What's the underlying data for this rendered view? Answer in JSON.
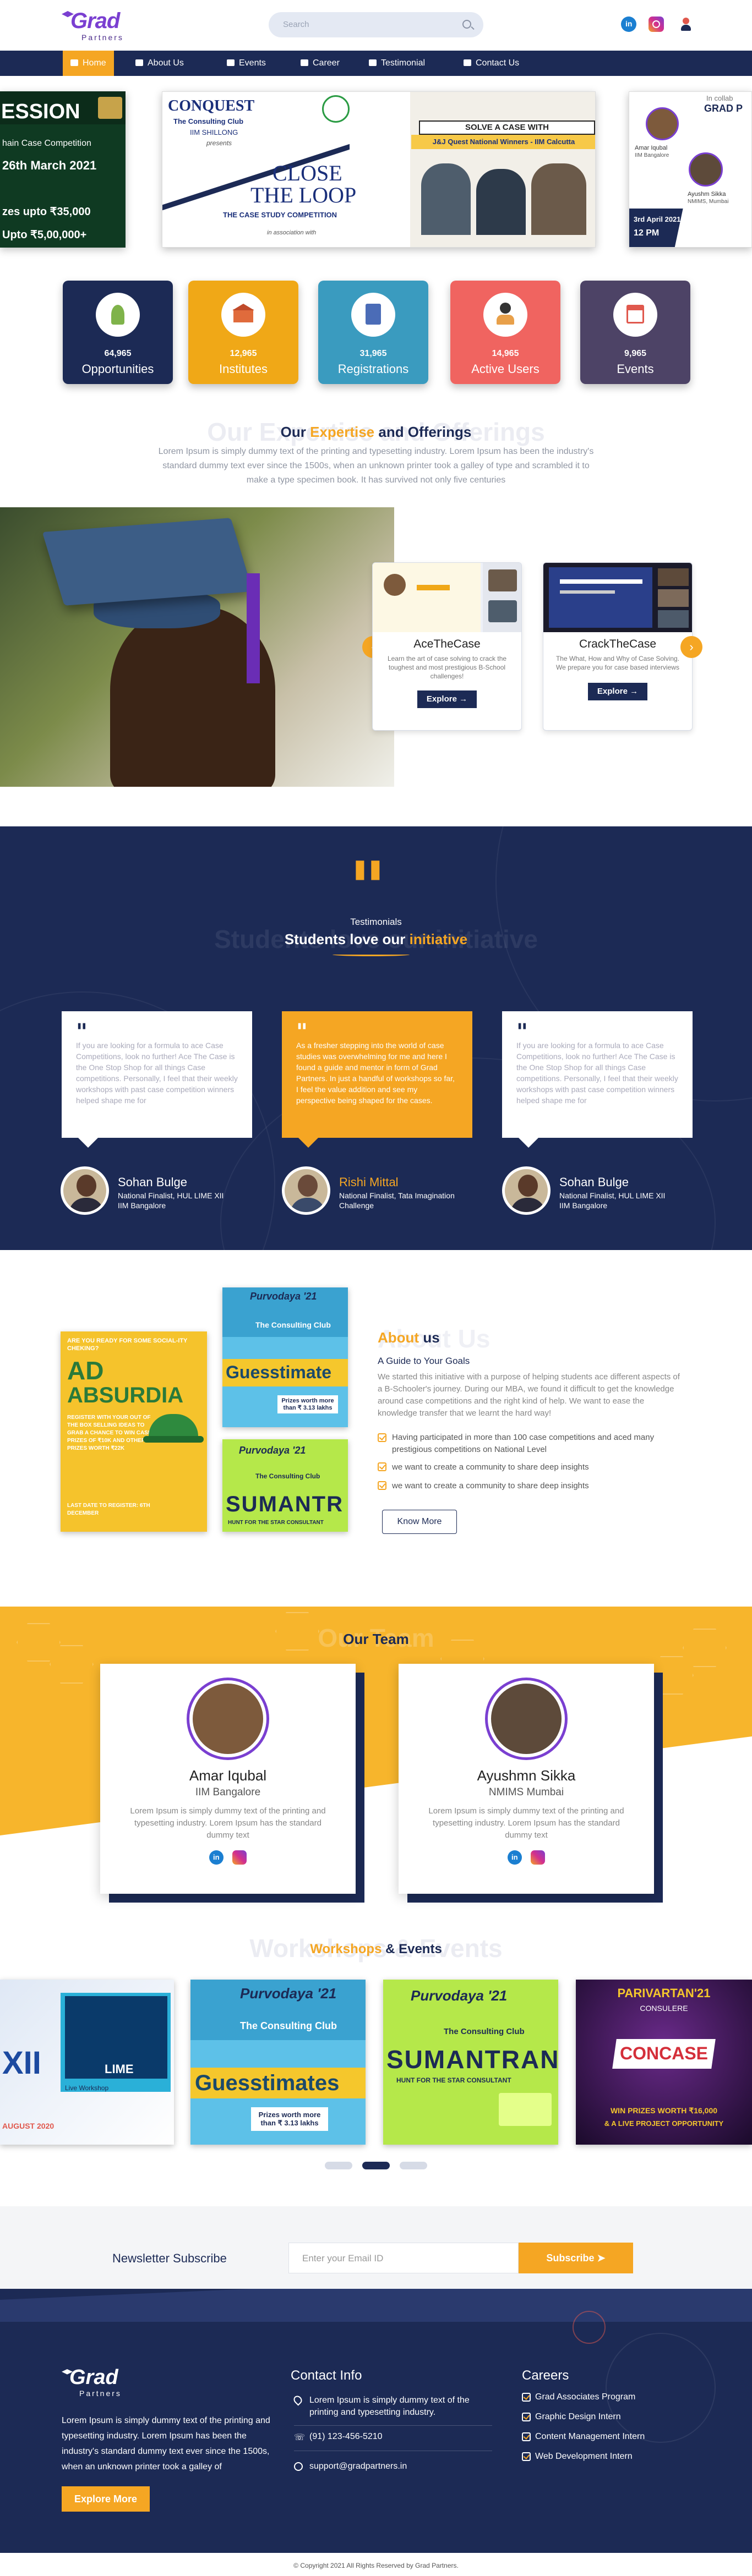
{
  "header": {
    "logo_text": "Grad",
    "logo_sub": "Partners",
    "search_placeholder": "Search"
  },
  "nav": {
    "items": [
      "Home",
      "About Us",
      "Events",
      "Career",
      "Testimonial",
      "Contact Us"
    ]
  },
  "banners": {
    "left": {
      "title": "ESSION",
      "line1": "hain Case Competition",
      "line2": "26th March 2021",
      "line3": "zes upto ₹35,000",
      "line4": "Upto ₹5,00,000+"
    },
    "center": {
      "title1": "CONQUEST",
      "title2": "The Consulting Club",
      "title3": "IIM SHILLONG",
      "title4": "presents",
      "big1": "CLOSE",
      "big2": "THE LOOP",
      "sub": "THE CASE STUDY COMPETITION",
      "assoc": "in association with",
      "right_head": "SOLVE A CASE WITH",
      "right_sub": "J&J Quest National Winners - IIM Calcutta"
    },
    "right": {
      "brand": "GRAD P",
      "name1": "Amar Iqubal",
      "sch1": "IIM Bangalore",
      "name2": "Ayushm Sikka",
      "sch2": "NMIMS, Mumbai",
      "date": "3rd April 2021",
      "time": "12 PM",
      "tag": "In collab"
    }
  },
  "stats": [
    {
      "num": "64,965",
      "label": "Opportunities",
      "color": "#1c2a55"
    },
    {
      "num": "12,965",
      "label": "Institutes",
      "color": "#f0a817"
    },
    {
      "num": "31,965",
      "label": "Registrations",
      "color": "#3a9bbf"
    },
    {
      "num": "14,965",
      "label": "Active Users",
      "color": "#f06460"
    },
    {
      "num": "9,965",
      "label": "Events",
      "color": "#4d4366"
    }
  ],
  "expertise": {
    "ghost": "Our Expertise and Offerings",
    "pre": "Our ",
    "accent": "Expertise",
    "post": " and Offerings",
    "desc": "Lorem Ipsum is simply dummy text of the printing and typesetting industry. Lorem Ipsum has been the industry's standard dummy text ever since the 1500s, when an unknown printer took a galley of type and scrambled it to make a type specimen book. It has survived not only five centuries",
    "cards": [
      {
        "title": "AceTheCase",
        "desc": "Learn the art of case solving to crack the toughest and most prestigious B-School challenges!",
        "btn": "Explore"
      },
      {
        "title": "CrackTheCase",
        "desc": "The What, How and Why of Case Solving. We prepare you for case based interviews",
        "btn": "Explore"
      }
    ]
  },
  "testimonials": {
    "label": "Testimonials",
    "ghost": "Students love our initiative",
    "pre": "Students love our ",
    "accent": "initiative",
    "cards": [
      {
        "text": "If you are looking for a formula to ace Case Competitions, look no further! Ace The Case is the One Stop Shop for all things Case competitions. Personally, I feel that their weekly workshops with past case competition winners helped shape me for",
        "name": "Sohan Bulge",
        "role1": "National Finalist, HUL LIME XII",
        "role2": "IIM Bangalore"
      },
      {
        "text": "As a fresher stepping into the world of case studies was overwhelming for me and here I found a guide and mentor in form of Grad Partners. In just a handful of workshops so far, I feel the value addition and see my perspective being shaped for the cases.",
        "name": "Rishi Mittal",
        "role1": "National Finalist, Tata Imagination",
        "role2": "Challenge"
      },
      {
        "text": "If you are looking for a formula to ace Case Competitions, look no further! Ace The Case is the One Stop Shop for all things Case competitions. Personally, I feel that their weekly workshops with past case competition winners helped shape me for",
        "name": "Sohan Bulge",
        "role1": "National Finalist, HUL LIME XII",
        "role2": "IIM Bangalore"
      }
    ]
  },
  "about": {
    "ghost": "About Us",
    "accent": "About",
    "post": " us",
    "subtitle": "A Guide to Your Goals",
    "desc": "We started this initiative with a purpose of helping students ace different aspects of a B-Schooler's journey. During our MBA, we found it difficult to get the knowledge around case competitions and the right kind of help. We want to ease the knowledge transfer that we learnt the hard way!",
    "points": [
      "Having participated in more than 100 case competitions and aced many prestigious competitions on National Level",
      "we want to create a community to share deep insights",
      "we want to create a community to share deep insights"
    ],
    "btn": "Know More",
    "poster1": {
      "top": "ARE YOU READY FOR SOME SOCIAL-ITY CHEKING?",
      "big1": "AD",
      "big2": "ABSURDIA",
      "body": "REGISTER WITH YOUR OUT OF THE BOX SELLING IDEAS TO GRAB A CHANCE TO WIN CASH PRIZES OF ₹10K AND OTHER PRIZES WORTH ₹22K",
      "foot": "LAST DATE TO REGISTER: 6TH DECEMBER"
    },
    "poster2": {
      "brand": "Purvodaya '21",
      "club": "The Consulting Club",
      "big": "Guesstimate",
      "prize": "Prizes worth more than ₹ 3.13 lakhs"
    },
    "poster3": {
      "brand": "Purvodaya '21",
      "club": "The Consulting Club",
      "big": "SUMANTR",
      "tag": "HUNT FOR THE STAR CONSULTANT"
    }
  },
  "team": {
    "ghost": "Our Team",
    "pre": "Our ",
    "accent": "Team",
    "members": [
      {
        "name": "Amar Iqubal",
        "school": "IIM Bangalore",
        "desc": "Lorem Ipsum is simply dummy text of the printing and typesetting industry. Lorem Ipsum has the standard dummy text"
      },
      {
        "name": "Ayushmn Sikka",
        "school": "NMIMS Mumbai",
        "desc": "Lorem Ipsum is simply dummy text of the printing and typesetting industry. Lorem Ipsum has the standard dummy text"
      }
    ]
  },
  "workshops": {
    "ghost": "Workshops & Events",
    "accent": "Workshops",
    "post": " & Events",
    "posters": [
      {
        "big": "XII",
        "tag": "LIME",
        "foot": "AUGUST 2020",
        "caption": "Live Workshop"
      },
      {
        "brand": "Purvodaya '21",
        "club": "The Consulting Club",
        "big": "Guesstimates",
        "prize": "Prizes worth more than ₹ 3.13 lakhs"
      },
      {
        "brand": "Purvodaya '21",
        "club": "The Consulting Club",
        "big": "SUMANTRAN",
        "tag": "HUNT FOR THE STAR CONSULTANT"
      },
      {
        "brand": "PARIVARTAN'21",
        "club": "CONSULERE",
        "big": "CONCASE",
        "prize": "WIN PRIZES WORTH ₹16,000",
        "tag": "& A LIVE PROJECT OPPORTUNITY"
      }
    ]
  },
  "newsletter": {
    "title": "Newsletter Subscribe",
    "placeholder": "Enter your Email ID",
    "btn": "Subscribe"
  },
  "footer": {
    "about": "Lorem Ipsum is simply dummy text of the printing and typesetting industry. Lorem Ipsum has been the industry's standard dummy text ever since the 1500s, when an unknown printer took a galley of",
    "btn": "Explore More",
    "contact_title": "Contact Info",
    "address": "Lorem Ipsum is simply dummy text of the printing and typesetting industry.",
    "phone": "(91) 123-456-5210",
    "email": "support@gradpartners.in",
    "careers_title": "Careers",
    "careers": [
      "Grad Associates Program",
      "Graphic Design Intern",
      "Content Management Intern",
      "Web Development Intern"
    ],
    "copyright": "© Copyright 2021 All Rights Reserved by Grad Partners."
  },
  "colors": {
    "navy": "#1c2a55",
    "orange": "#f5a623",
    "purple": "#7a3fd1"
  }
}
